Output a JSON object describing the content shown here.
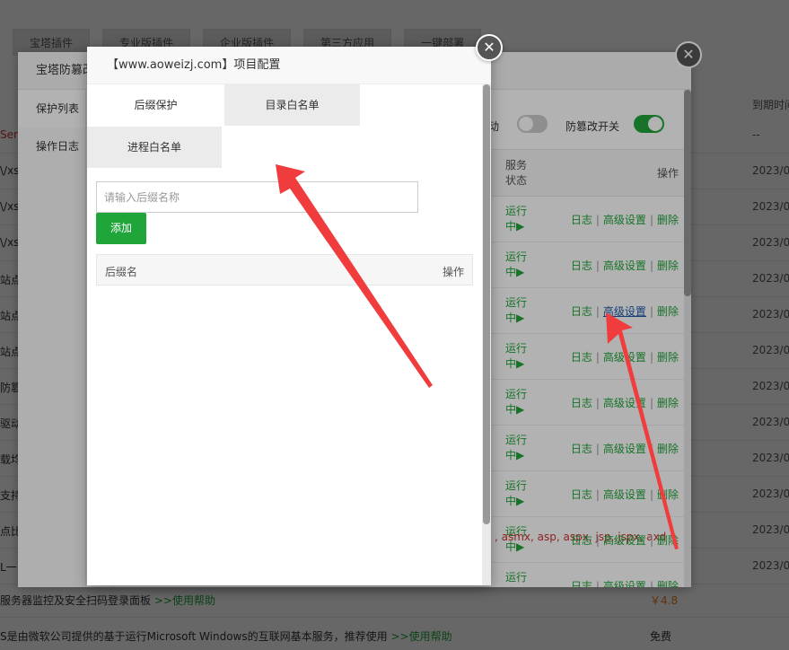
{
  "store_tabs": [
    "宝塔插件",
    "专业版插件",
    "企业版插件",
    "第三方应用",
    "一键部署"
  ],
  "background_rows": [
    {
      "left": "Serv",
      "red": true,
      "date": "--"
    },
    {
      "left": "\\/xs",
      "red": false,
      "date": "2023/0"
    },
    {
      "left": "\\/xs",
      "red": false,
      "date": "2023/0"
    },
    {
      "left": "\\/xs",
      "red": false,
      "date": "2023/0"
    },
    {
      "left": "站点",
      "red": false,
      "date": "2023/0"
    },
    {
      "left": "站点",
      "red": false,
      "date": "2023/0"
    },
    {
      "left": "站点",
      "red": false,
      "date": "2023/0"
    },
    {
      "left": "防篡",
      "red": false,
      "date": "2023/0"
    },
    {
      "left": "驱动",
      "red": false,
      "date": "2023/0"
    },
    {
      "left": "载均",
      "red": false,
      "date": "2023/0"
    },
    {
      "left": "支持",
      "red": false,
      "date": "2023/0"
    },
    {
      "left": "点比",
      "red": false,
      "date": "2023/0"
    },
    {
      "left": "L一",
      "red": false,
      "date": "2023/0"
    }
  ],
  "background_header_date": "到期时间",
  "background_bottom": [
    {
      "text": "服务器监控及安全扫码登录面板",
      "link": ">>使用帮助",
      "price": "￥4.8",
      "paid": true
    },
    {
      "text": "S是由微软公司提供的基于运行Microsoft Windows的互联网基本服务，推荐使用",
      "link": ">>使用帮助",
      "price": "免费",
      "paid": false
    }
  ],
  "panel2": {
    "title": "宝塔防篡改",
    "side_items": [
      "保护列表",
      "操作日志"
    ],
    "toggle1_label": "动",
    "toggle2_label": "防篡改开关",
    "col_status": "服务状态",
    "col_ops": "操作",
    "rows": [
      {
        "status": "运行中▶",
        "log": "日志",
        "adv": "高级设置",
        "del": "删除",
        "ext": ""
      },
      {
        "status": "运行中▶",
        "log": "日志",
        "adv": "高级设置",
        "del": "删除",
        "ext": ""
      },
      {
        "status": "运行中▶",
        "log": "日志",
        "adv": "高级设置",
        "del": "删除",
        "ext": ""
      },
      {
        "status": "运行中▶",
        "log": "日志",
        "adv": "高级设置",
        "del": "删除",
        "ext": ""
      },
      {
        "status": "运行中▶",
        "log": "日志",
        "adv": "高级设置",
        "del": "删除",
        "ext": ""
      },
      {
        "status": "运行中▶",
        "log": "日志",
        "adv": "高级设置",
        "del": "删除",
        "ext": ""
      },
      {
        "status": "运行中▶",
        "log": "日志",
        "adv": "高级设置",
        "del": "删除",
        "ext": ""
      },
      {
        "status": "运行中▶",
        "log": "日志",
        "adv": "高级设置",
        "del": "删除",
        "ext": ", asmx, asp, aspx, jsp, jspx, axd"
      },
      {
        "status": "运行中▶",
        "log": "日志",
        "adv": "高级设置",
        "del": "删除",
        "ext": ""
      }
    ]
  },
  "dialog": {
    "title": "【www.aoweizj.com】项目配置",
    "tabs": [
      "后缀保护",
      "目录白名单",
      "进程白名单"
    ],
    "input_placeholder": "请输入后缀名称",
    "add_label": "添加",
    "col_name": "后缀名",
    "col_ops": "操作"
  },
  "close_glyph": "✕",
  "colors": {
    "accent": "#20a53a",
    "arrow": "#f03c3c",
    "link_hover": "#1e5aa8",
    "price": "#f37b1d"
  }
}
